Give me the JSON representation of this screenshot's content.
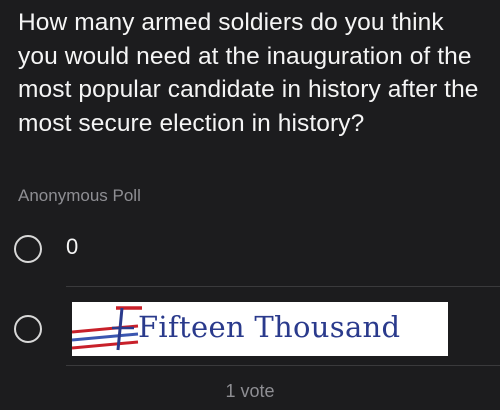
{
  "poll": {
    "question": "How many armed soldiers do you think you would need at the inauguration of the most popular candidate in history after the most secure election in history?",
    "type_label": "Anonymous Poll",
    "options": [
      {
        "label": "0"
      },
      {
        "image_text": "Fifteen Thousand"
      }
    ],
    "vote_count": "1 vote"
  },
  "colors": {
    "background": "#1c1c1e",
    "text": "#f5f5f5",
    "muted": "#8e8e93",
    "image_text": "#2a3a8c",
    "image_red": "#c8202a",
    "image_blue": "#3a56b0"
  },
  "icons": {
    "radio": "radio-unselected-icon"
  }
}
